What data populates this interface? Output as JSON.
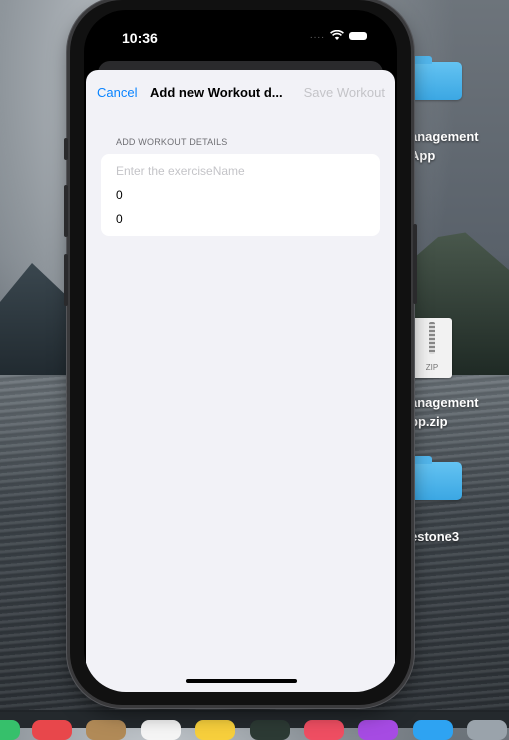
{
  "status_bar": {
    "time": "10:36",
    "signal": "....",
    "wifi_icon": "wifi-icon",
    "battery_icon": "battery-icon"
  },
  "nav": {
    "cancel_label": "Cancel",
    "title": "Add new Workout d...",
    "save_label": "Save Workout"
  },
  "form": {
    "section_header": "ADD WORKOUT DETAILS",
    "exercise_name_placeholder": "Enter the exerciseName",
    "exercise_name_value": "",
    "field_1_value": "0",
    "field_2_value": "0"
  },
  "desktop": {
    "items": [
      {
        "label_line1": "anagement",
        "label_line2": "App",
        "type": "folder"
      },
      {
        "label_line1": "anagement",
        "label_line2": "pp.zip",
        "type": "zip",
        "zip_label": "ZIP"
      },
      {
        "label_line1": "estone3",
        "type": "folder"
      }
    ]
  },
  "colors": {
    "accent": "#0a84ff",
    "disabled": "#c4c4c8",
    "sheet_background": "#f2f2f7",
    "folder": "#3ba7e3"
  }
}
